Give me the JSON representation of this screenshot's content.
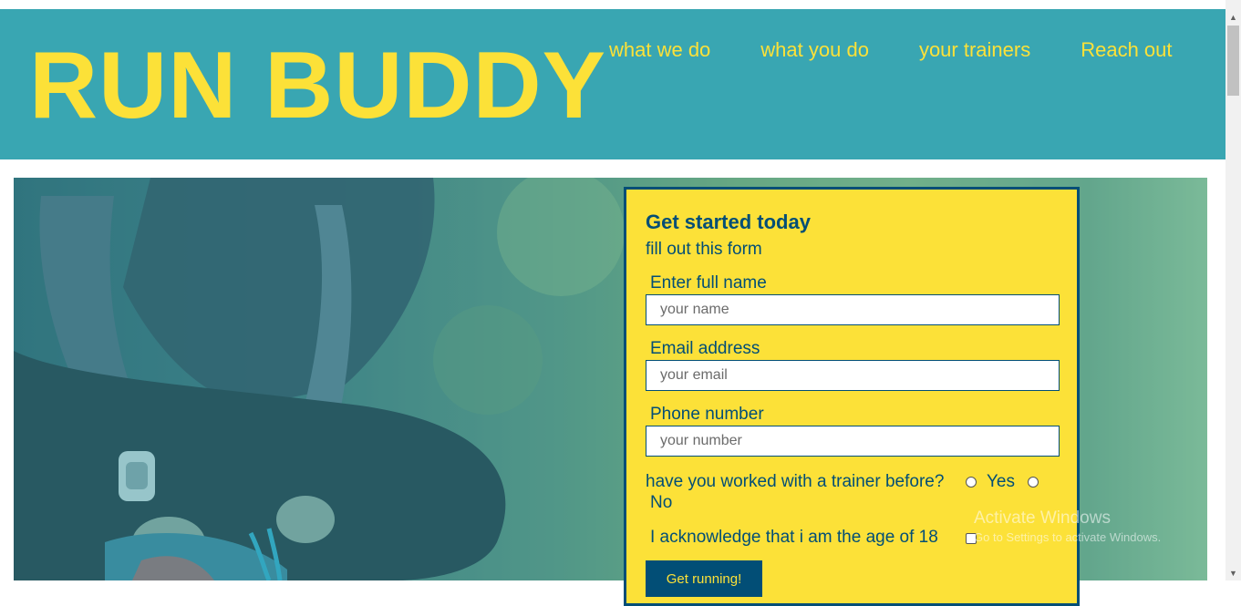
{
  "header": {
    "logo": "RUN BUDDY",
    "nav": [
      "what we do",
      "what you do",
      "your trainers",
      "Reach out"
    ]
  },
  "form": {
    "title": "Get started today",
    "subtitle": "fill out this form",
    "name_label": "Enter full name",
    "name_placeholder": "your name",
    "email_label": "Email address",
    "email_placeholder": "your email",
    "phone_label": "Phone number",
    "phone_placeholder": "your number",
    "trainer_question": "have you worked with a trainer before?",
    "yes_label": "Yes",
    "no_label": "No",
    "acknowledge": "I acknowledge that i am the age of 18",
    "submit": "Get running!"
  },
  "watermark": {
    "line1": "Activate Windows",
    "line2": "Go to Settings to activate Windows."
  },
  "colors": {
    "header_bg": "#39a6b2",
    "accent_yellow": "#fce138",
    "navy": "#024e76"
  },
  "icons": [
    "scroll-up-arrow-icon",
    "scroll-down-arrow-icon"
  ]
}
